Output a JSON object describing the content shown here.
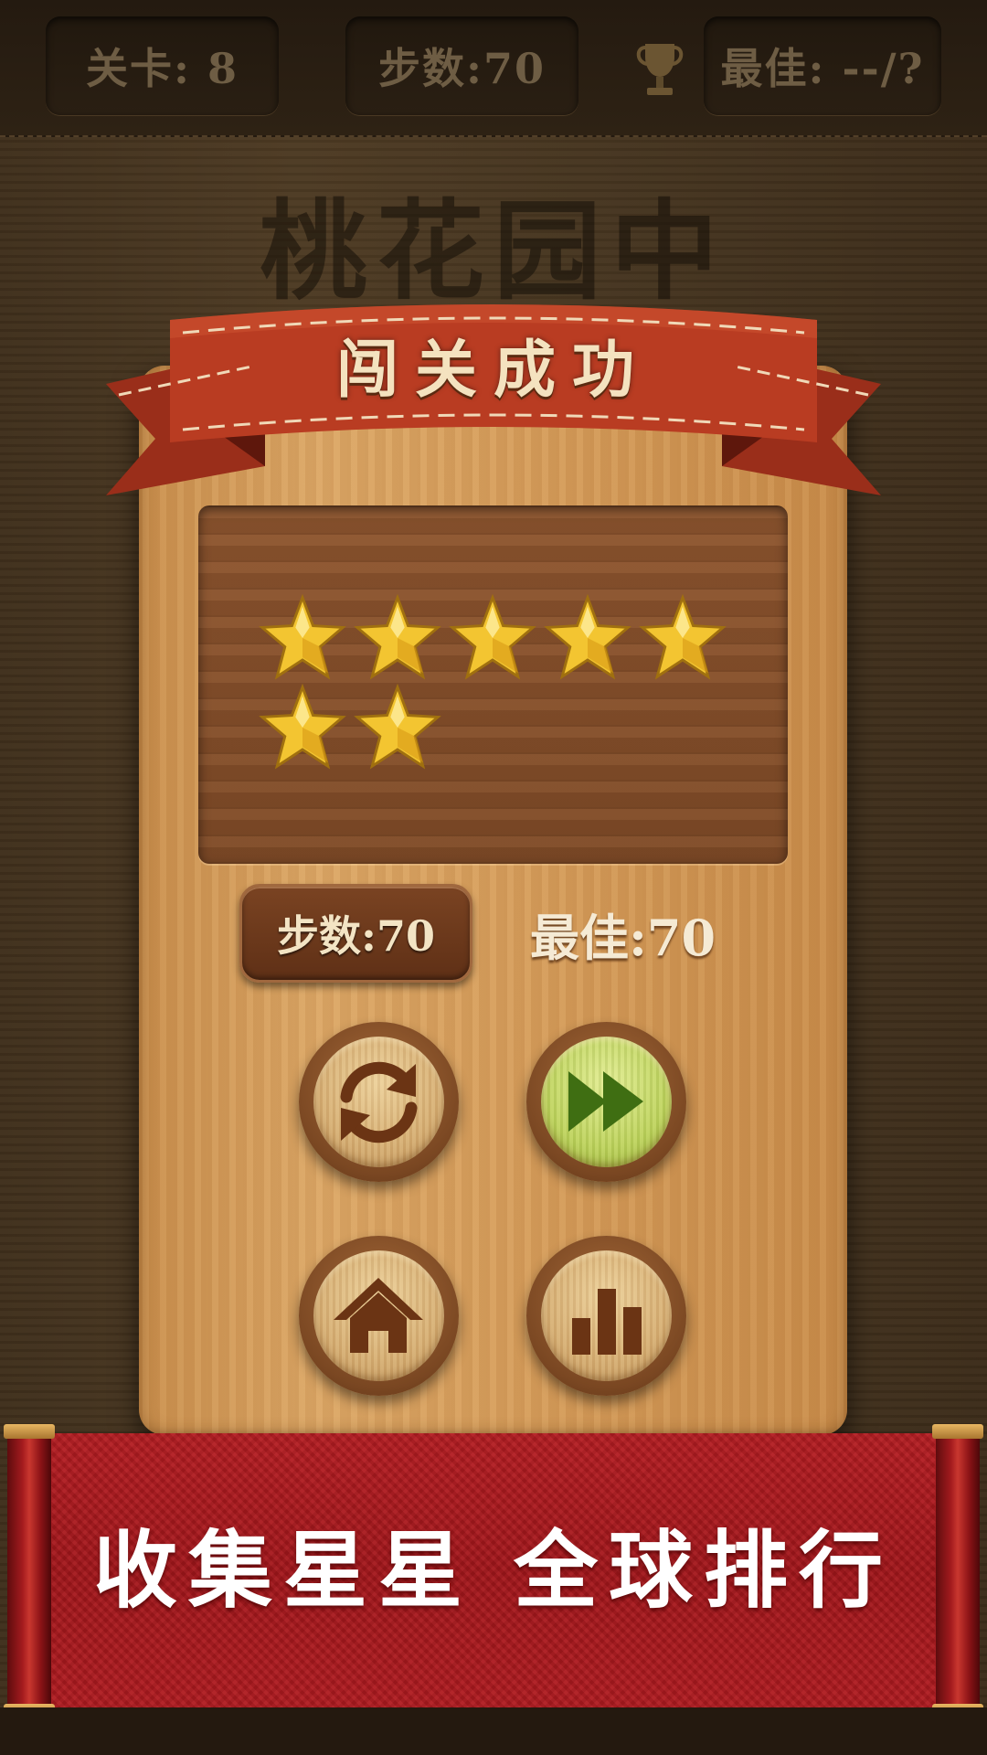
{
  "hud": {
    "level": "关卡: 8",
    "steps": "步数:70",
    "best": "最佳: --/?"
  },
  "background_title": "桃花园中",
  "dialog": {
    "title": "闯关成功",
    "stars_earned": 7,
    "steps_label": "步数:70",
    "best_label": "最佳:70"
  },
  "buttons": {
    "restart": "restart-icon",
    "next": "fast-forward-icon",
    "home": "home-icon",
    "rank": "bar-chart-icon"
  },
  "banner": {
    "text": "收集星星 全球排行"
  },
  "colors": {
    "ribbon": "#b73a22",
    "banner": "#b51d22",
    "next_button": "#bcd25c",
    "star": "#f3c531"
  }
}
